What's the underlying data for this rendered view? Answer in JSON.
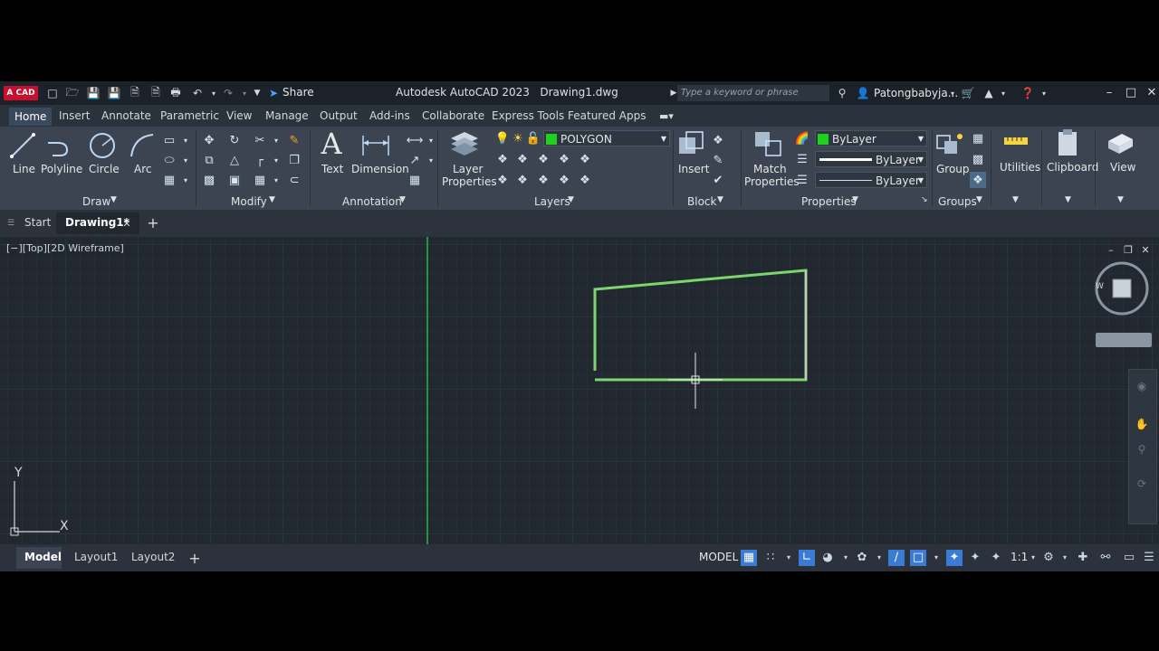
{
  "app": {
    "logo_text": "A CAD",
    "title": "Autodesk AutoCAD 2023",
    "document": "Drawing1.dwg",
    "share_label": "Share",
    "search_placeholder": "Type a keyword or phrase",
    "user": "Patongbabyja...",
    "accent_color": "#c8102e"
  },
  "ribbon_tabs": [
    "Home",
    "Insert",
    "Annotate",
    "Parametric",
    "View",
    "Manage",
    "Output",
    "Add-ins",
    "Collaborate",
    "Express Tools",
    "Featured Apps"
  ],
  "draw_panel": {
    "line": "Line",
    "polyline": "Polyline",
    "circle": "Circle",
    "arc": "Arc",
    "label": "Draw"
  },
  "modify_panel": {
    "label": "Modify"
  },
  "annotation_panel": {
    "text": "Text",
    "dimension": "Dimension",
    "label": "Annotation"
  },
  "layers_panel": {
    "layer_properties_1": "Layer",
    "layer_properties_2": "Properties",
    "current_layer": "POLYGON",
    "layer_color": "#1fd11f",
    "label": "Layers"
  },
  "block_panel": {
    "insert": "Insert",
    "label": "Block"
  },
  "properties_panel": {
    "match_1": "Match",
    "match_2": "Properties",
    "color": "ByLayer",
    "lineweight": "ByLayer",
    "linetype": "ByLayer",
    "label": "Properties"
  },
  "groups_panel": {
    "group": "Group",
    "label": "Groups"
  },
  "utilities": "Utilities",
  "clipboard": "Clipboard",
  "view": "View",
  "file_tabs": {
    "start": "Start",
    "drawing": "Drawing1*"
  },
  "viewport": {
    "label": "[−][Top][2D Wireframe]",
    "y_axis": "Y",
    "x_axis": "X",
    "compass_label": "W",
    "shape_color": "#7bd66b"
  },
  "status": {
    "model_tab": "Model",
    "layout1": "Layout1",
    "layout2": "Layout2",
    "model_label": "MODEL",
    "scale": "1:1"
  }
}
